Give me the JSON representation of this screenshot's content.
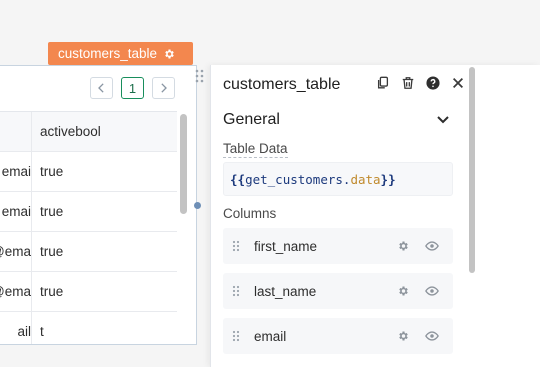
{
  "widget": {
    "name": "customers_table"
  },
  "table": {
    "pagination": {
      "prev_icon": "chevron-left",
      "current_page": "1",
      "next_icon": "chevron-right"
    },
    "columns": [
      "activebool"
    ],
    "rows": [
      {
        "email": "emai",
        "activebool": "true"
      },
      {
        "email": "emai",
        "activebool": "true"
      },
      {
        "email": "@ema",
        "activebool": "true"
      },
      {
        "email": "@ema",
        "activebool": "true"
      },
      {
        "email": "ail",
        "activebool": "t"
      }
    ]
  },
  "inspector": {
    "title": "customers_table",
    "actions": [
      "copy-icon",
      "trash-icon",
      "help-icon",
      "close-icon"
    ],
    "section": {
      "title": "General"
    },
    "table_data": {
      "label": "Table Data",
      "open": "{{",
      "ident": "get_customers",
      "dot": ".",
      "prop": "data",
      "close": "}}"
    },
    "columns": {
      "label": "Columns",
      "items": [
        {
          "name": "first_name"
        },
        {
          "name": "last_name"
        },
        {
          "name": "email"
        }
      ]
    }
  },
  "colors": {
    "accent": "#f3874e",
    "brand_green": "#188e5c",
    "code_blue": "#1d3a7d",
    "code_gold": "#c08a2d"
  }
}
